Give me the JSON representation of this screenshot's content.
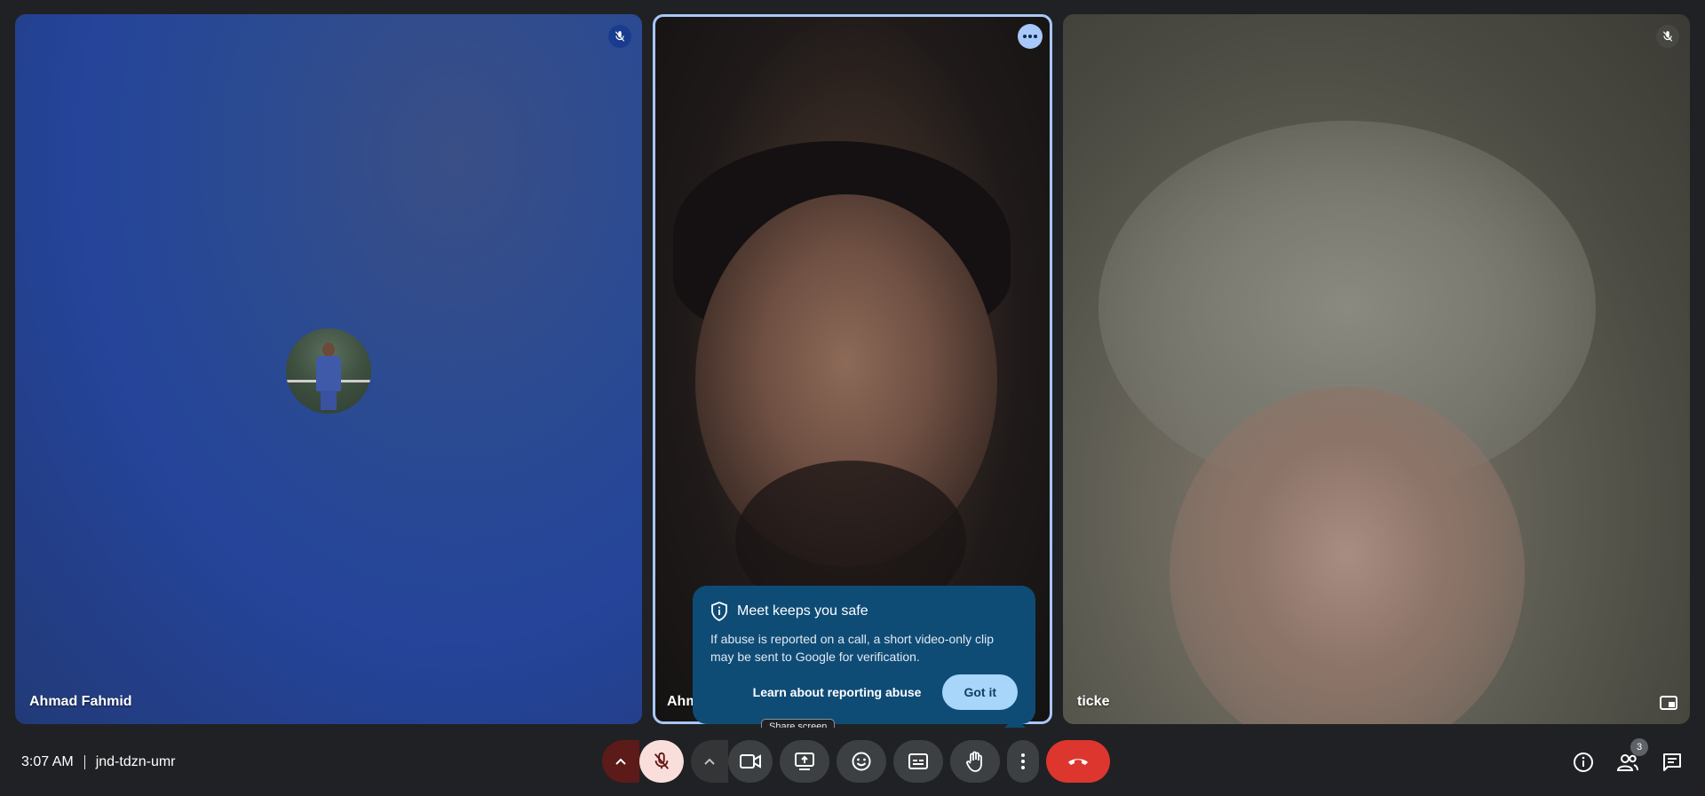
{
  "participants": [
    {
      "name": "Ahmad Fahmid",
      "mic": "muted",
      "avatar": "profile-photo"
    },
    {
      "name": "Ahm",
      "mic": "active",
      "highlighted": true
    },
    {
      "name": "ticke",
      "mic": "muted"
    }
  ],
  "popup": {
    "title": "Meet keeps you safe",
    "body": "If abuse is reported on a call, a short video-only clip may be sent to Google for verification.",
    "link": "Learn about reporting abuse",
    "button": "Got it"
  },
  "tooltip": {
    "share": "Share screen"
  },
  "meeting": {
    "time": "3:07 AM",
    "code": "jnd-tdzn-umr"
  },
  "people_count": "3",
  "colors": {
    "end_call": "#dc362e",
    "highlight": "#a8c7fa",
    "popup_bg": "#0e4c76",
    "mic_on": "#f9dedc"
  }
}
